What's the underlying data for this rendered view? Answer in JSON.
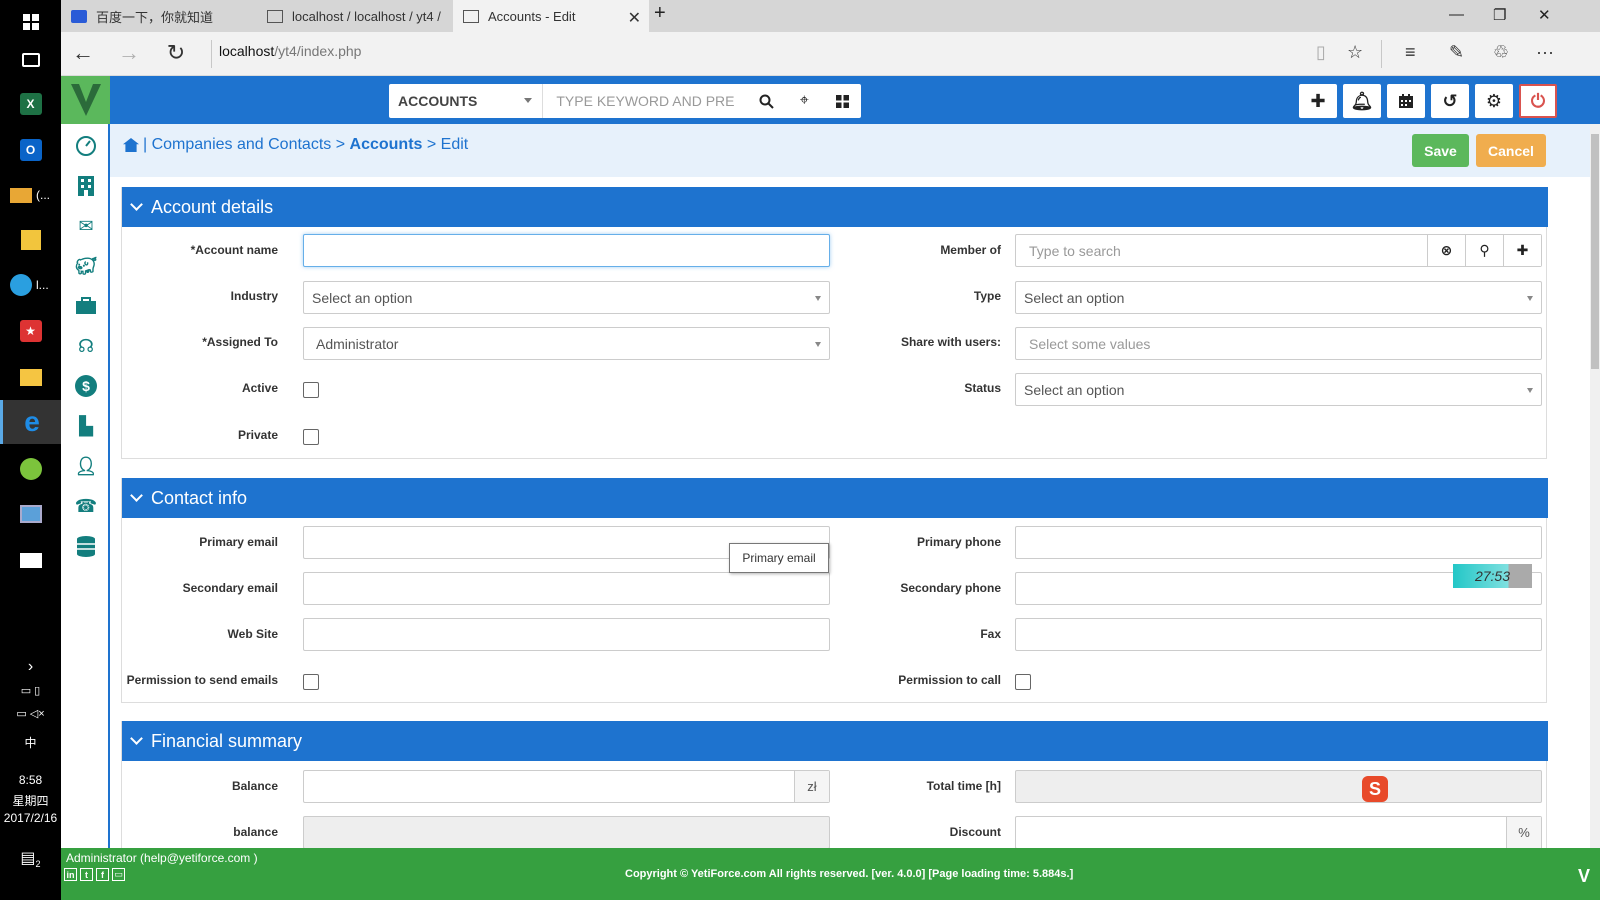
{
  "taskbar": {
    "time": "8:58",
    "weekday": "星期四",
    "date": "2017/2/16",
    "ime": "中",
    "mail_label": "(...",
    "app_label": "l...",
    "notifications_count": "2"
  },
  "browser": {
    "tabs": [
      {
        "title": "百度一下，你就知道"
      },
      {
        "title": "localhost / localhost / yt4 / "
      },
      {
        "title": "Accounts - Edit"
      }
    ],
    "url_host": "localhost",
    "url_path": "/yt4/index.php"
  },
  "header": {
    "module": "ACCOUNTS",
    "search_placeholder": "TYPE KEYWORD AND PRE"
  },
  "breadcrumb": {
    "section": "| Companies and Contacts",
    "sep1": ">",
    "module": "Accounts",
    "sep2": ">",
    "action": "Edit"
  },
  "buttons": {
    "save": "Save",
    "cancel": "Cancel"
  },
  "account_details": {
    "title": "Account details",
    "account_name_label": "*Account name",
    "industry_label": "Industry",
    "industry_value": "Select an option",
    "assigned_label": "*Assigned To",
    "assigned_value": "Administrator",
    "active_label": "Active",
    "private_label": "Private",
    "member_of_label": "Member of",
    "member_of_placeholder": "Type to search",
    "type_label": "Type",
    "type_value": "Select an option",
    "share_label": "Share with users:",
    "share_placeholder": "Select some values",
    "status_label": "Status",
    "status_value": "Select an option"
  },
  "contact_info": {
    "title": "Contact info",
    "primary_email_label": "Primary email",
    "secondary_email_label": "Secondary email",
    "website_label": "Web Site",
    "perm_email_label": "Permission to send emails",
    "primary_phone_label": "Primary phone",
    "secondary_phone_label": "Secondary phone",
    "fax_label": "Fax",
    "perm_call_label": "Permission to call"
  },
  "tooltip": "Primary email",
  "timer": "27:53",
  "financial": {
    "title": "Financial summary",
    "balance_label": "Balance",
    "balance_currency": "zł",
    "balance2_label": "balance",
    "total_time_label": "Total time [h]",
    "discount_label": "Discount",
    "discount_unit": "%"
  },
  "footer": {
    "user": "Administrator  (help@yetiforce.com )",
    "copyright": "Copyright © YetiForce.com All rights reserved. [ver. 4.0.0] [Page loading time: 5.884s.]"
  },
  "colors": {
    "primary": "#1e73cf",
    "success": "#5cb85c",
    "warning": "#f0ad4e",
    "footer": "#36a040"
  }
}
